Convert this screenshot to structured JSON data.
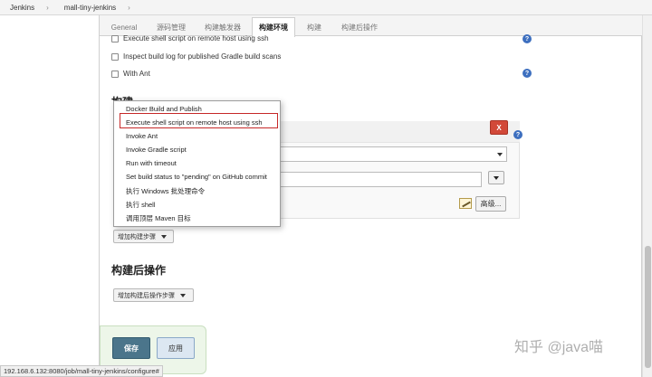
{
  "breadcrumb": {
    "items": [
      "Jenkins",
      "mall-tiny-jenkins"
    ],
    "separator": "›"
  },
  "tabs": [
    {
      "label": "General",
      "active": false
    },
    {
      "label": "源码管理",
      "active": false
    },
    {
      "label": "构建触发器",
      "active": false
    },
    {
      "label": "构建环境",
      "active": true
    },
    {
      "label": "构建",
      "active": false
    },
    {
      "label": "构建后操作",
      "active": false
    }
  ],
  "build_env": {
    "options": [
      "Execute shell script on remote host using ssh",
      "Inspect build log for published Gradle build scans",
      "With Ant"
    ]
  },
  "build": {
    "title": "构建",
    "delete_label": "X",
    "advanced_label": "高级...",
    "add_step_label": "增加构建步骤"
  },
  "dropdown": {
    "items": [
      "Docker Build and Publish",
      "Execute shell script on remote host using ssh",
      "Invoke Ant",
      "Invoke Gradle script",
      "Run with timeout",
      "Set build status to \"pending\" on GitHub commit",
      "执行 Windows 批处理命令",
      "执行 shell",
      "调用顶层 Maven 目标"
    ],
    "highlighted_index": 1
  },
  "post_build": {
    "title": "构建后操作",
    "add_step_label": "增加构建后操作步骤"
  },
  "actions": {
    "save_label": "保存",
    "apply_label": "应用"
  },
  "status_url": "192.168.6.132:8080/job/mall-tiny-jenkins/configure#",
  "watermark": "知乎 @java喵",
  "colors": {
    "highlight_border": "#c62828",
    "delete_button": "#d24939",
    "save_button": "#4b758b",
    "help_icon": "#3d6fbf"
  }
}
